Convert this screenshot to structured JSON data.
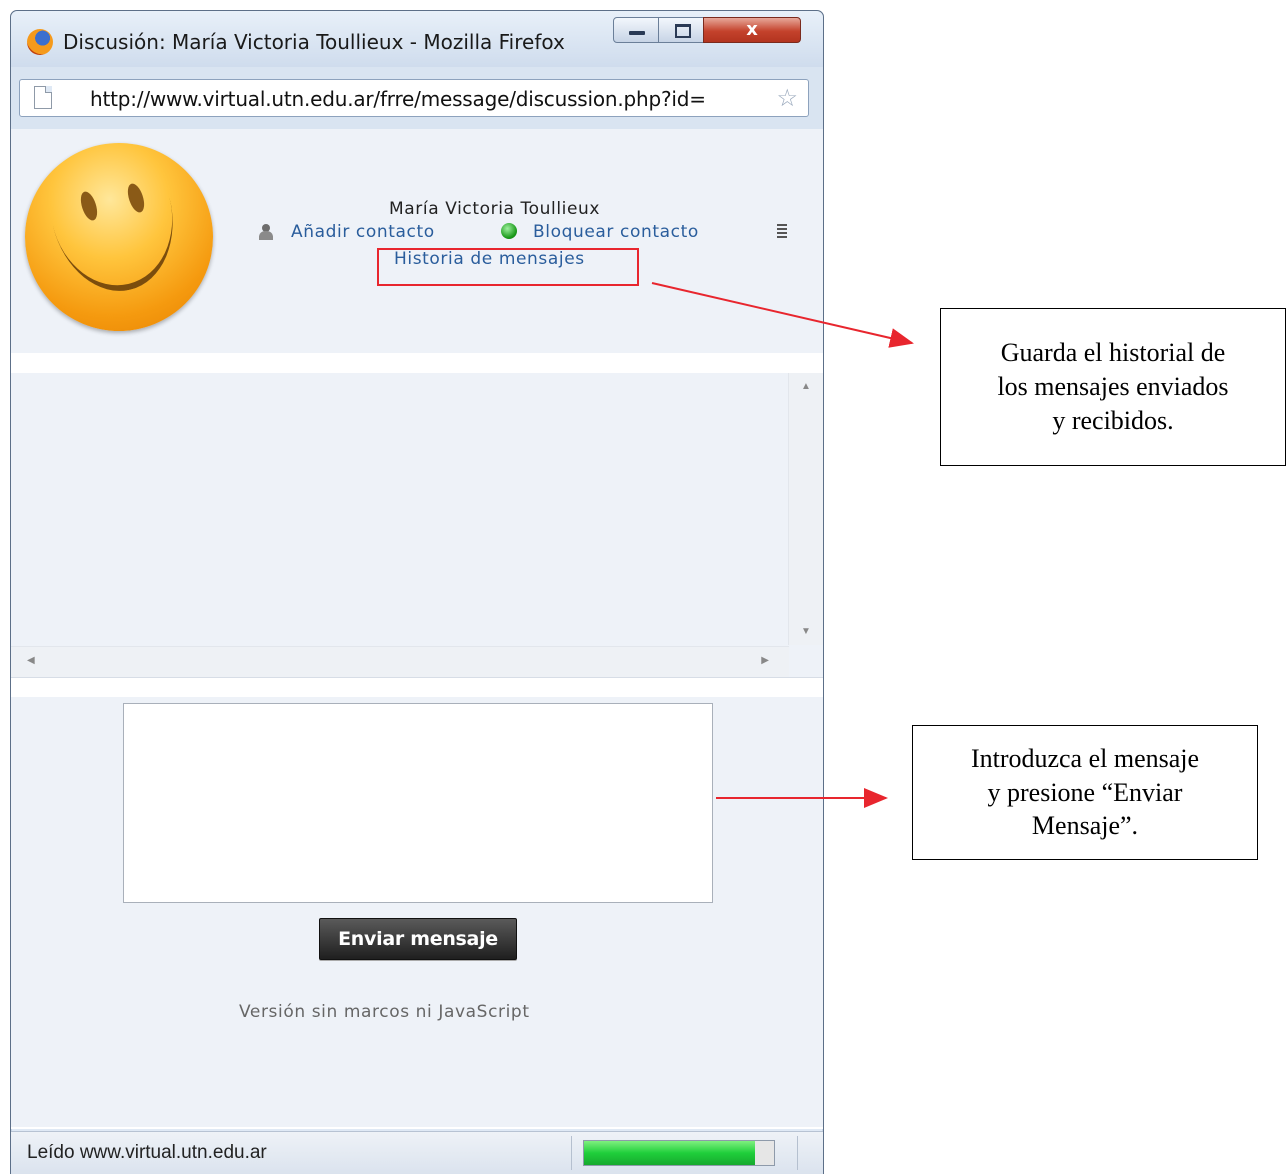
{
  "window": {
    "title": "Discusión: María Victoria Toullieux - Mozilla Firefox",
    "url": "http://www.virtual.utn.edu.ar/frre/message/discussion.php?id="
  },
  "header": {
    "user_name": "María Victoria Toullieux",
    "add_contact": "Añadir contacto",
    "block_contact": "Bloquear contacto",
    "history": "Historia de mensajes"
  },
  "compose": {
    "message_value": "",
    "send_label": "Enviar mensaje",
    "no_frames_link": "Versión sin marcos ni JavaScript"
  },
  "status": {
    "text": "Leído www.virtual.utn.edu.ar",
    "progress": 0.9
  },
  "annotations": {
    "history_note": "Guarda el historial de\nlos mensajes enviados\ny recibidos.",
    "send_note": "Introduzca el mensaje\ny presione “Enviar\nMensaje”.",
    "arrow_color": "#e8262e"
  },
  "icons": [
    "firefox-logo-icon",
    "minimize-icon",
    "maximize-icon",
    "close-icon",
    "page-icon",
    "bookmark-star-icon",
    "smiley-avatar",
    "add-contact-icon",
    "block-contact-icon",
    "menu-lines-icon"
  ]
}
